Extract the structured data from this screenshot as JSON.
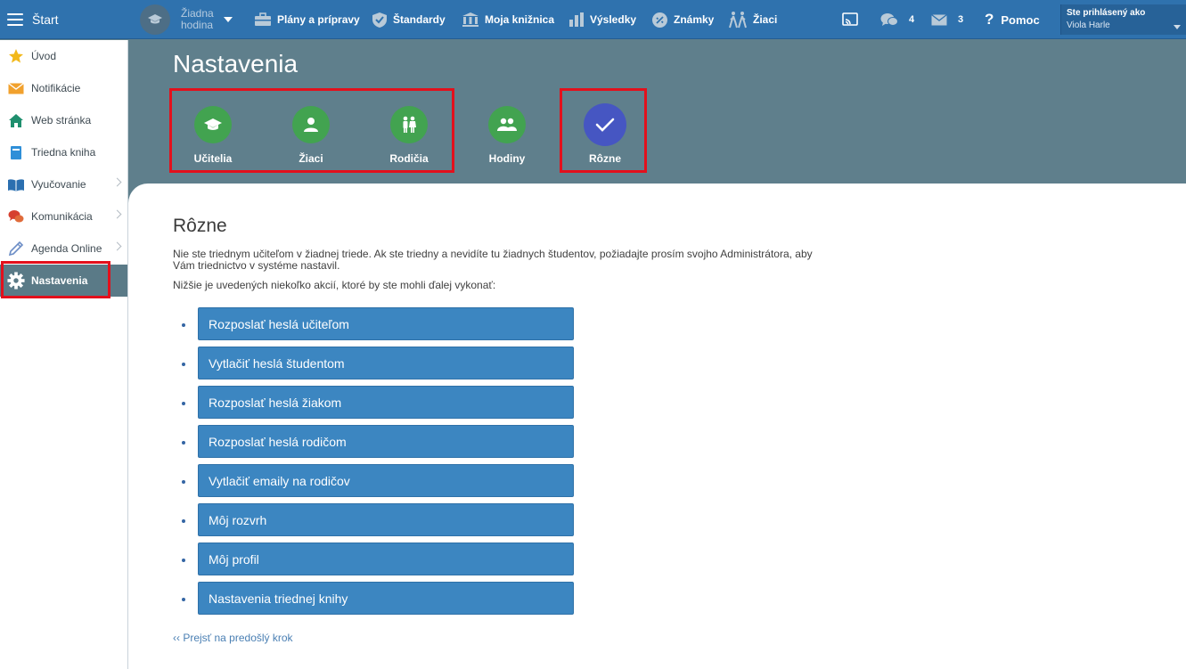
{
  "topbar": {
    "start": "Štart",
    "class_selector": "Žiadna hodina",
    "nav": [
      "Plány a prípravy",
      "Štandardy",
      "Moja knižnica",
      "Výsledky",
      "Známky",
      "Žiaci"
    ],
    "chat_count": "4",
    "mail_count": "3",
    "help": "Pomoc",
    "logged_as_label": "Ste prihlásený ako",
    "user_name": "Viola Harle"
  },
  "sidebar": {
    "items": [
      {
        "label": "Úvod",
        "icon": "star-icon"
      },
      {
        "label": "Notifikácie",
        "icon": "envelope-icon"
      },
      {
        "label": "Web stránka",
        "icon": "home-icon"
      },
      {
        "label": "Triedna kniha",
        "icon": "book-icon"
      },
      {
        "label": "Vyučovanie",
        "icon": "open-book-icon"
      },
      {
        "label": "Komunikácia",
        "icon": "chat-icon"
      },
      {
        "label": "Agenda Online",
        "icon": "pencil-icon"
      },
      {
        "label": "Nastavenia",
        "icon": "gear-icon"
      }
    ]
  },
  "page": {
    "title": "Nastavenia",
    "tabs": [
      {
        "label": "Učitelia",
        "icon": "graduation-cap-icon"
      },
      {
        "label": "Žiaci",
        "icon": "person-icon"
      },
      {
        "label": "Rodičia",
        "icon": "parents-icon"
      },
      {
        "label": "Hodiny",
        "icon": "group-icon"
      },
      {
        "label": "Rôzne",
        "icon": "check-icon"
      }
    ]
  },
  "content": {
    "title": "Rôzne",
    "intro": "Nie ste triednym učiteľom v žiadnej triede. Ak ste triedny a nevidíte tu žiadnych študentov, požiadajte prosím svojho Administrátora, aby Vám triednictvo v systéme nastavil.",
    "intro2": "Nižšie je uvedených niekoľko akcií, ktoré by ste mohli ďalej vykonať:",
    "actions": [
      "Rozposlať heslá učiteľom",
      "Vytlačiť heslá študentom",
      "Rozposlať heslá žiakom",
      "Rozposlať heslá rodičom",
      "Vytlačiť emaily na rodičov",
      "Môj rozvrh",
      "Môj profil",
      "Nastavenia triednej knihy"
    ],
    "back_link": "‹‹ Prejsť na predošlý krok"
  },
  "colors": {
    "topbar": "#2f72ae",
    "header_bg": "#5f7f8c",
    "tab_green": "#42a350",
    "tab_selected": "#4656c2",
    "action_blue": "#3c86c1",
    "highlight_red": "#e3101c"
  }
}
